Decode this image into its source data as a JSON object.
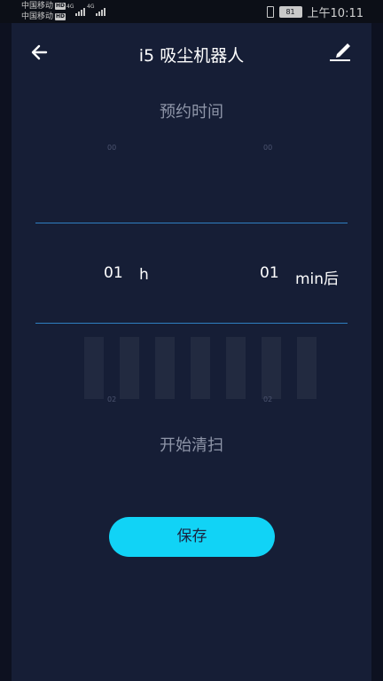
{
  "status_bar": {
    "carrier_1": "中国移动",
    "carrier_2": "中国移动",
    "hd_1": "HD",
    "hd_2": "HD",
    "network_1": "4G",
    "network_2": "4G",
    "battery": "81",
    "time": "上午10:11"
  },
  "header": {
    "title": "i5 吸尘机器人",
    "back_icon": "arrow-left-icon",
    "edit_icon": "pencil-icon"
  },
  "schedule": {
    "title": "预约时间",
    "hours": {
      "above": "00",
      "selected": "01",
      "below": "02",
      "unit": "h"
    },
    "minutes": {
      "above": "00",
      "selected": "01",
      "below": "02",
      "unit": "min后"
    }
  },
  "action_label": "开始清扫",
  "save_label": "保存",
  "colors": {
    "background": "#161e36",
    "accent": "#11d3f6",
    "picker_line": "#2f7fc2",
    "muted_text": "#8e95a8"
  }
}
